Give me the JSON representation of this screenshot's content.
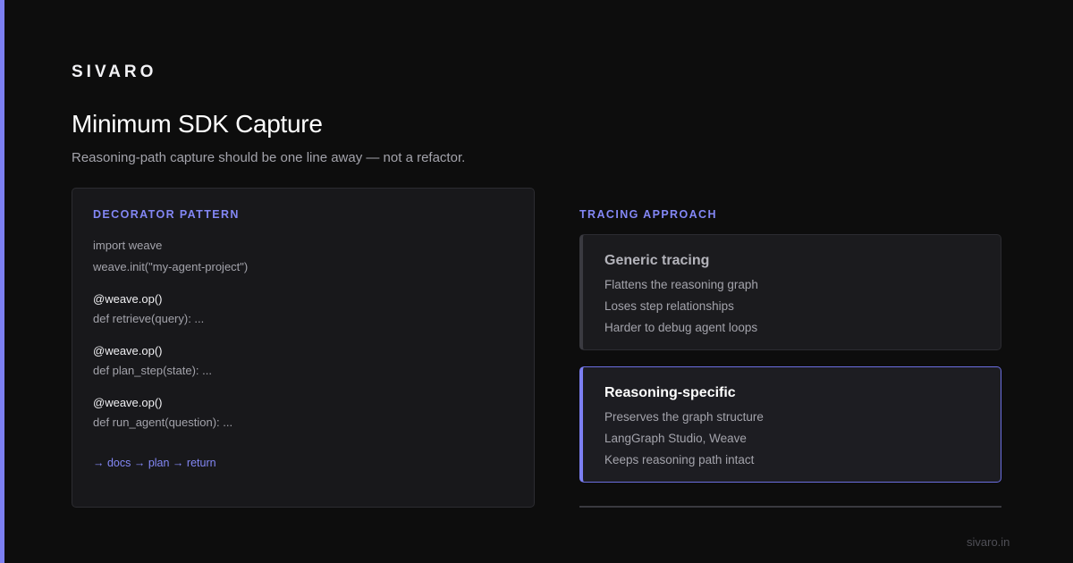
{
  "brand": "SIVARO",
  "title": "Minimum SDK Capture",
  "subtitle": "Reasoning-path capture should be one line away — not a refactor.",
  "code_panel": {
    "heading": "DECORATOR PATTERN",
    "lines": [
      "import weave",
      "weave.init(\"my-agent-project\")",
      "@weave.op()",
      "def retrieve(query): ...",
      "@weave.op()",
      "def plan_step(state): ...",
      "@weave.op()",
      "def run_agent(question): ..."
    ],
    "flow": "→ docs → plan → return"
  },
  "tracing": {
    "heading": "TRACING APPROACH",
    "cards": [
      {
        "title": "Generic tracing",
        "items": [
          "Flattens the reasoning graph",
          "Loses step relationships",
          "Harder to debug agent loops"
        ]
      },
      {
        "title": "Reasoning-specific",
        "items": [
          "Preserves the graph structure",
          "LangGraph Studio, Weave",
          "Keeps reasoning path intact"
        ]
      }
    ]
  },
  "footer": "sivaro.in",
  "colors": {
    "accent": "#7c7ff2",
    "background": "#0d0d0d",
    "panel": "#18181b"
  }
}
